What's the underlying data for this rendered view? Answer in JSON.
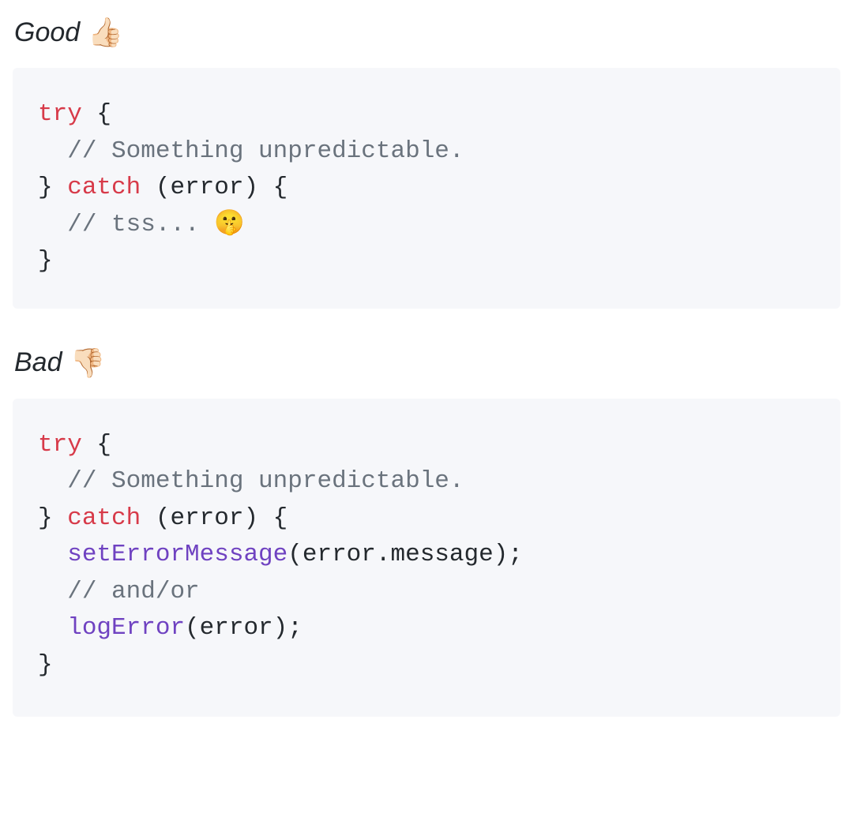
{
  "sections": {
    "good": {
      "label": "Good",
      "emoji": "👍🏻",
      "code": {
        "line1": {
          "try": "try",
          "brace": " {"
        },
        "line2": {
          "comment": "// Something unpredictable."
        },
        "line3": {
          "brace1": "} ",
          "catch": "catch",
          "rest": " (error) {"
        },
        "line4": {
          "comment_prefix": "// tss... ",
          "emoji": "🤫"
        },
        "line5": {
          "brace": "}"
        }
      }
    },
    "bad": {
      "label": "Bad",
      "emoji": "👎🏻",
      "code": {
        "line1": {
          "try": "try",
          "brace": " {"
        },
        "line2": {
          "comment": "// Something unpredictable."
        },
        "line3": {
          "brace1": "} ",
          "catch": "catch",
          "rest": " (error) {"
        },
        "line4": {
          "fn": "setErrorMessage",
          "args": "(error.message);"
        },
        "line5": {
          "comment": "// and/or"
        },
        "line6": {
          "fn": "logError",
          "args": "(error);"
        },
        "line7": {
          "brace": "}"
        }
      }
    }
  }
}
